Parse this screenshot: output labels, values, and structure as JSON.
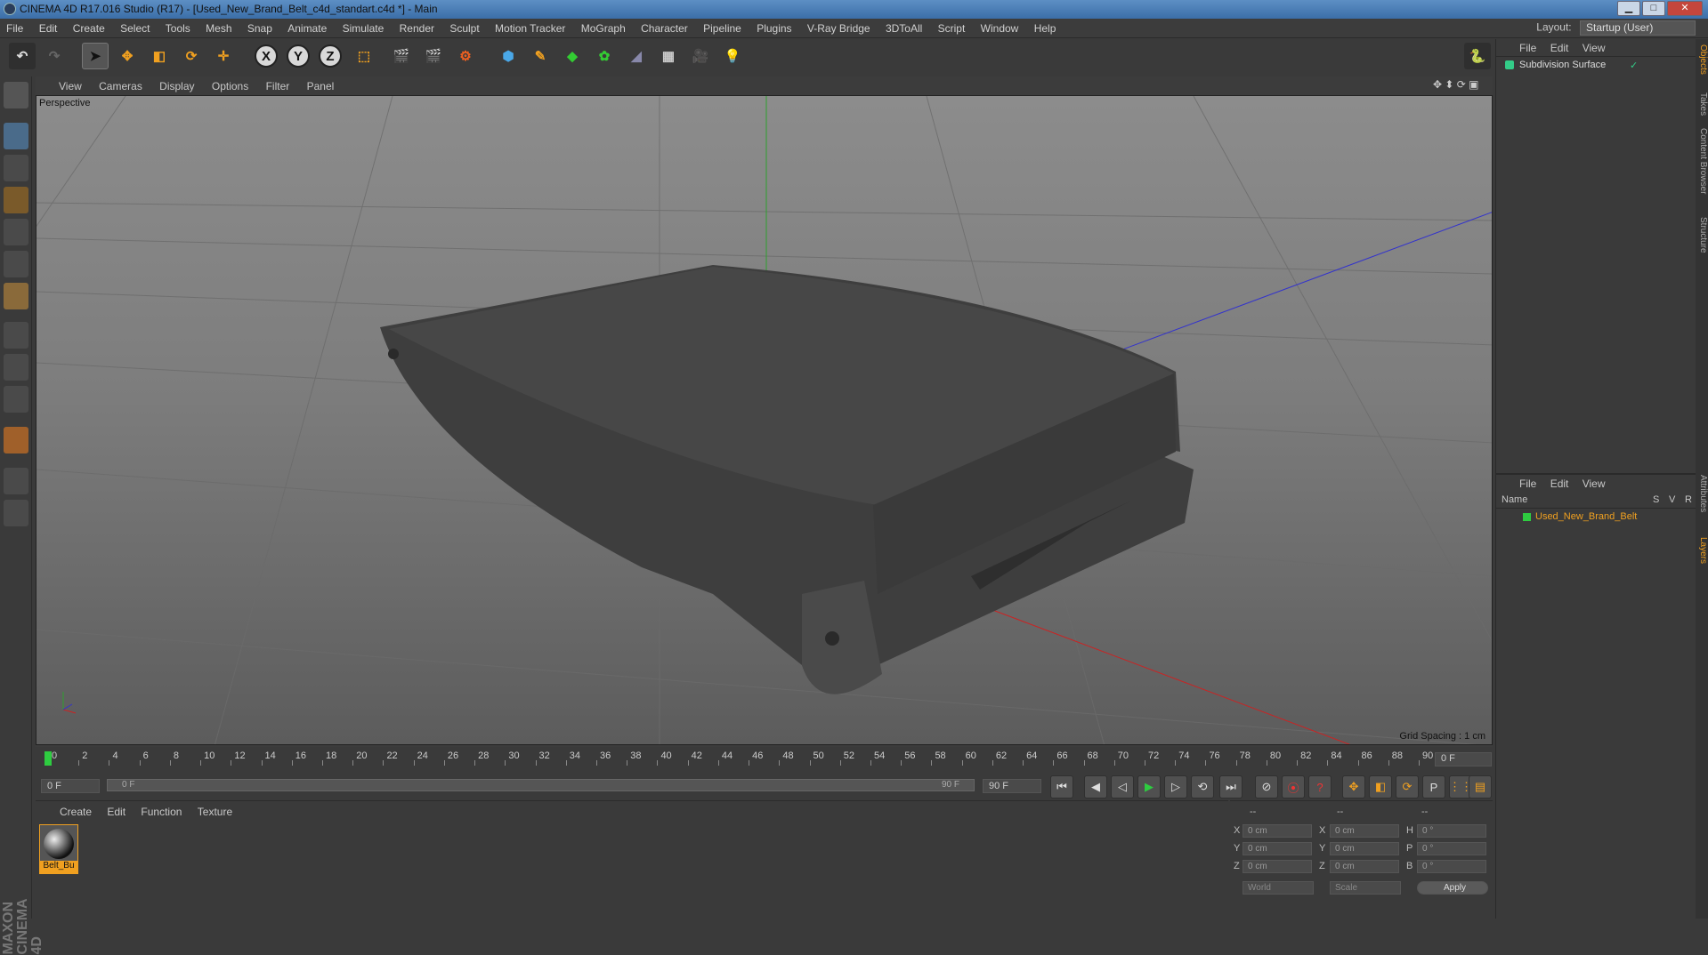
{
  "title": "CINEMA 4D R17.016 Studio (R17) - [Used_New_Brand_Belt_c4d_standart.c4d *] - Main",
  "menu": [
    "File",
    "Edit",
    "Create",
    "Select",
    "Tools",
    "Mesh",
    "Snap",
    "Animate",
    "Simulate",
    "Render",
    "Sculpt",
    "Motion Tracker",
    "MoGraph",
    "Character",
    "Pipeline",
    "Plugins",
    "V-Ray Bridge",
    "3DToAll",
    "Script",
    "Window",
    "Help"
  ],
  "layout": {
    "label": "Layout:",
    "value": "Startup (User)"
  },
  "axis_buttons": [
    "X",
    "Y",
    "Z"
  ],
  "viewport": {
    "menu": [
      "View",
      "Cameras",
      "Display",
      "Options",
      "Filter",
      "Panel"
    ],
    "label": "Perspective",
    "grid_spacing": "Grid Spacing : 1 cm"
  },
  "timeline": {
    "ticks": [
      "0",
      "2",
      "4",
      "6",
      "8",
      "10",
      "12",
      "14",
      "16",
      "18",
      "20",
      "22",
      "24",
      "26",
      "28",
      "30",
      "32",
      "34",
      "36",
      "38",
      "40",
      "42",
      "44",
      "46",
      "48",
      "50",
      "52",
      "54",
      "56",
      "58",
      "60",
      "62",
      "64",
      "66",
      "68",
      "70",
      "72",
      "74",
      "76",
      "78",
      "80",
      "82",
      "84",
      "86",
      "88",
      "90"
    ],
    "current_frame": "0 F",
    "start_field": "0 F",
    "scrub_start": "0 F",
    "scrub_end": "90 F",
    "end_field": "90 F"
  },
  "material_panel": {
    "menu": [
      "Create",
      "Edit",
      "Function",
      "Texture"
    ],
    "material_name": "Belt_Bu"
  },
  "coords": {
    "header": [
      "--",
      "--",
      "--"
    ],
    "rows": [
      {
        "a": "X",
        "av": "0 cm",
        "b": "X",
        "bv": "0 cm",
        "c": "H",
        "cv": "0 °"
      },
      {
        "a": "Y",
        "av": "0 cm",
        "b": "Y",
        "bv": "0 cm",
        "c": "P",
        "cv": "0 °"
      },
      {
        "a": "Z",
        "av": "0 cm",
        "b": "Z",
        "bv": "0 cm",
        "c": "B",
        "cv": "0 °"
      }
    ],
    "world": "World",
    "scale": "Scale",
    "apply": "Apply"
  },
  "objects_panel": {
    "menu": [
      "File",
      "Edit",
      "View"
    ],
    "item": "Subdivision Surface"
  },
  "layers_panel": {
    "menu": [
      "File",
      "Edit",
      "View"
    ],
    "cols": [
      "Name",
      "S",
      "V",
      "R"
    ],
    "item": "Used_New_Brand_Belt"
  },
  "side_tabs": [
    "Objects",
    "Takes",
    "Content Browser",
    "Structure",
    "Attributes",
    "Layers"
  ],
  "logo": "MAXON CINEMA 4D"
}
